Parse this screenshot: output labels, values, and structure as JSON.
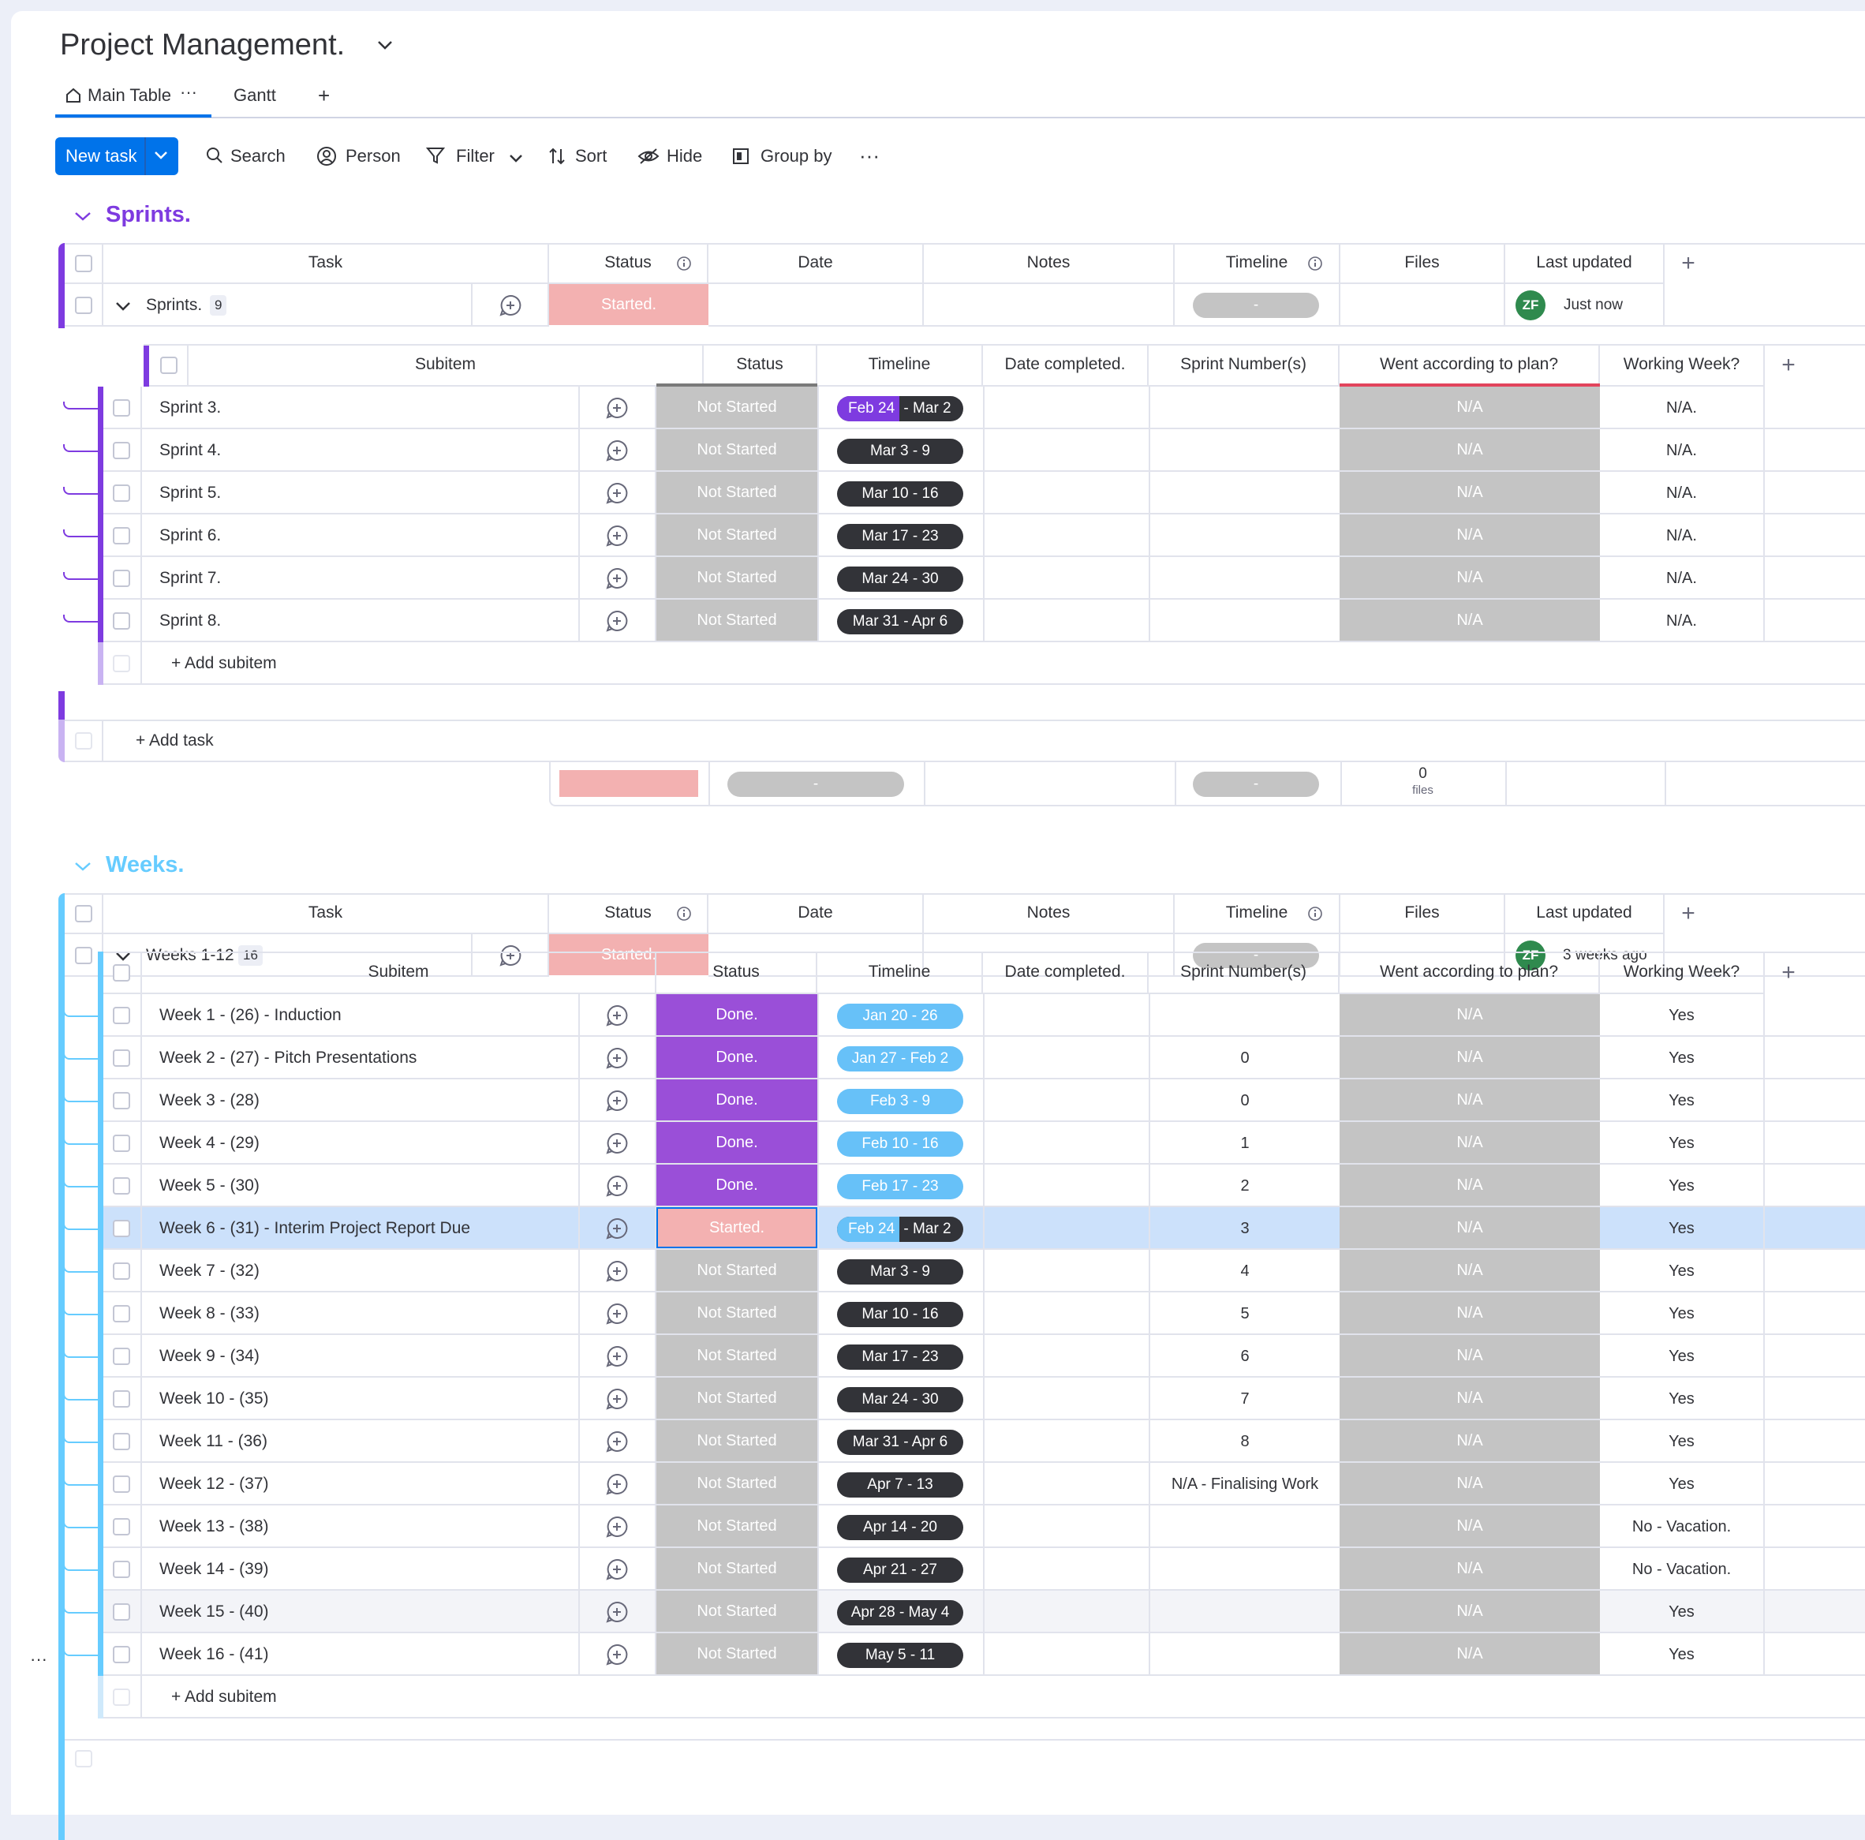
{
  "board": {
    "title": "Project Management.",
    "tabs": [
      {
        "label": "Main Table"
      },
      {
        "label": "Gantt"
      }
    ],
    "add_tab": "+",
    "tab_more": "···"
  },
  "toolbar": {
    "new_task": "New task",
    "search": "Search",
    "person": "Person",
    "filter": "Filter",
    "sort": "Sort",
    "hide": "Hide",
    "group_by": "Group by",
    "more": "···"
  },
  "columns": {
    "task": "Task",
    "status": "Status",
    "date": "Date",
    "notes": "Notes",
    "timeline": "Timeline",
    "files": "Files",
    "last_updated": "Last updated",
    "add": "+"
  },
  "subcolumns": {
    "subitem": "Subitem",
    "status": "Status",
    "timeline": "Timeline",
    "date_completed": "Date completed.",
    "sprint_numbers": "Sprint Number(s)",
    "went_to_plan": "Went according to plan?",
    "working_week": "Working Week?",
    "add": "+"
  },
  "colors": {
    "purple": "#7e3be0",
    "light_blue": "#66ccff",
    "started": "#f3b1b1",
    "not_started": "#c4c4c4",
    "done": "#9a4fd8",
    "selected_row": "#cce1fb"
  },
  "groups": [
    {
      "name": "Sprints.",
      "color": "#7e3be0",
      "item": {
        "name": "Sprints.",
        "count": "9",
        "status": "Started.",
        "timeline": "-",
        "avatar": "ZF",
        "last_updated": "Just now"
      },
      "add_subitem": "+ Add subitem",
      "add_task": "+ Add task",
      "summary": {
        "date": "-",
        "timeline": "-",
        "files_count": "0",
        "files_label": "files"
      },
      "subitems": [
        {
          "name": "Sprint 3.",
          "status": "Not Started",
          "timeline": "Mar 2",
          "timeline_start": "Feb 24",
          "sprint": "",
          "plan": "N/A",
          "week": "N/A."
        },
        {
          "name": "Sprint 4.",
          "status": "Not Started",
          "timeline": "Mar 3 - 9",
          "sprint": "",
          "plan": "N/A",
          "week": "N/A."
        },
        {
          "name": "Sprint 5.",
          "status": "Not Started",
          "timeline": "Mar 10 - 16",
          "sprint": "",
          "plan": "N/A",
          "week": "N/A."
        },
        {
          "name": "Sprint 6.",
          "status": "Not Started",
          "timeline": "Mar 17 - 23",
          "sprint": "",
          "plan": "N/A",
          "week": "N/A."
        },
        {
          "name": "Sprint 7.",
          "status": "Not Started",
          "timeline": "Mar 24 - 30",
          "sprint": "",
          "plan": "N/A",
          "week": "N/A."
        },
        {
          "name": "Sprint 8.",
          "status": "Not Started",
          "timeline": "Mar 31 - Apr 6",
          "sprint": "",
          "plan": "N/A",
          "week": "N/A."
        }
      ]
    },
    {
      "name": "Weeks.",
      "color": "#66ccff",
      "item": {
        "name": "Weeks 1-12",
        "count": "16",
        "status": "Started.",
        "timeline": "-",
        "avatar": "ZF",
        "last_updated": "3 weeks ago"
      },
      "add_subitem": "+ Add subitem",
      "subitems": [
        {
          "name": "Week 1 - (26) - Induction",
          "status": "Done.",
          "timeline": "Jan 20 - 26",
          "sprint": "",
          "plan": "N/A",
          "week": "Yes"
        },
        {
          "name": "Week 2 - (27) - Pitch Presentations",
          "status": "Done.",
          "timeline": "Jan 27 - Feb 2",
          "sprint": "0",
          "plan": "N/A",
          "week": "Yes"
        },
        {
          "name": "Week 3 - (28)",
          "status": "Done.",
          "timeline": "Feb 3 - 9",
          "sprint": "0",
          "plan": "N/A",
          "week": "Yes"
        },
        {
          "name": "Week 4 - (29)",
          "status": "Done.",
          "timeline": "Feb 10 - 16",
          "sprint": "1",
          "plan": "N/A",
          "week": "Yes"
        },
        {
          "name": "Week 5 - (30)",
          "status": "Done.",
          "timeline": "Feb 17 - 23",
          "sprint": "2",
          "plan": "N/A",
          "week": "Yes"
        },
        {
          "name": "Week 6 - (31) - Interim Project Report Due",
          "status": "Started.",
          "timeline": "Mar 2",
          "timeline_start": "Feb 24",
          "sprint": "3",
          "plan": "N/A",
          "week": "Yes"
        },
        {
          "name": "Week 7 - (32)",
          "status": "Not Started",
          "timeline": "Mar 3 - 9",
          "sprint": "4",
          "plan": "N/A",
          "week": "Yes"
        },
        {
          "name": "Week 8 - (33)",
          "status": "Not Started",
          "timeline": "Mar 10 - 16",
          "sprint": "5",
          "plan": "N/A",
          "week": "Yes"
        },
        {
          "name": "Week 9 - (34)",
          "status": "Not Started",
          "timeline": "Mar 17 - 23",
          "sprint": "6",
          "plan": "N/A",
          "week": "Yes"
        },
        {
          "name": "Week 10 - (35)",
          "status": "Not Started",
          "timeline": "Mar 24 - 30",
          "sprint": "7",
          "plan": "N/A",
          "week": "Yes"
        },
        {
          "name": "Week 11 - (36)",
          "status": "Not Started",
          "timeline": "Mar 31 - Apr 6",
          "sprint": "8",
          "plan": "N/A",
          "week": "Yes"
        },
        {
          "name": "Week 12 - (37)",
          "status": "Not Started",
          "timeline": "Apr 7 - 13",
          "sprint": "N/A - Finalising Work",
          "plan": "N/A",
          "week": "Yes"
        },
        {
          "name": "Week 13 - (38)",
          "status": "Not Started",
          "timeline": "Apr 14 - 20",
          "sprint": "",
          "plan": "N/A",
          "week": "No - Vacation."
        },
        {
          "name": "Week 14 - (39)",
          "status": "Not Started",
          "timeline": "Apr 21 - 27",
          "sprint": "",
          "plan": "N/A",
          "week": "No - Vacation."
        },
        {
          "name": "Week 15 - (40)",
          "status": "Not Started",
          "timeline": "Apr 28 - May 4",
          "sprint": "",
          "plan": "N/A",
          "week": "Yes"
        },
        {
          "name": "Week 16 - (41)",
          "status": "Not Started",
          "timeline": "May 5 - 11",
          "sprint": "",
          "plan": "N/A",
          "week": "Yes"
        }
      ]
    }
  ],
  "row_menu": "···"
}
